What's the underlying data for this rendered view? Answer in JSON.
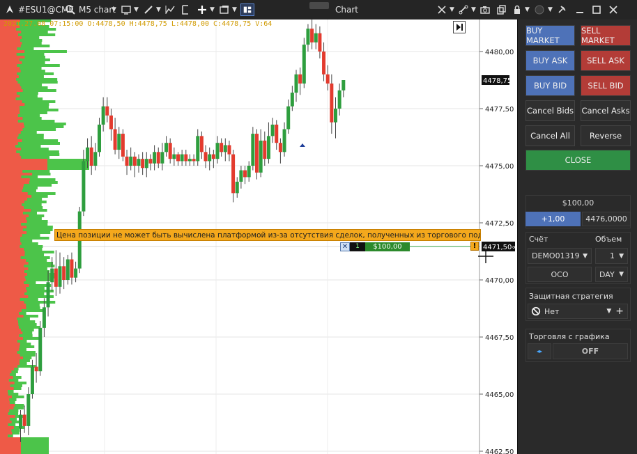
{
  "toolbar": {
    "symbol": "#ESU1@CME",
    "timeframe": "M5 chart",
    "window_title": "Chart",
    "icons": [
      "app-logo-icon",
      "search-icon",
      "chevron-down-icon",
      "display-icon",
      "pencil-icon",
      "line-chart-icon",
      "template-icon",
      "crosshair-plus-icon",
      "window-icon",
      "layout-icon",
      "tools-icon",
      "link-icon",
      "camera-icon",
      "copy-icon",
      "lock-icon",
      "circle-icon",
      "pin-icon",
      "minimize-icon",
      "maximize-icon",
      "close-icon"
    ]
  },
  "chart": {
    "ohlc_text": "2021.27.08 07:15:00 O:4478,50 H:4478,75 L:4478,00 C:4478,75 V:64",
    "price_labels": [
      "4480,00",
      "4477,50",
      "4475,00",
      "4472,50",
      "4470,00",
      "4467,50",
      "4465,00",
      "4462,50"
    ],
    "current_price_label": "4478,75",
    "position_price_label": "4471,50",
    "position_price_suffix": "∞",
    "warning_text": "Цена позиции не может быть вычислена платформой из-за отсутствия сделок, полученных из торгового подключения.",
    "position_qty": "1",
    "position_pnl": "$100,00",
    "warning_badge": "!",
    "colors": {
      "bull": "#2e9e3e",
      "bear": "#e33b2e",
      "profile_red": "#ee5a47",
      "profile_green": "#4cc44a"
    }
  },
  "panel": {
    "buy_market": "BUY MARKET",
    "sell_market": "SELL MARKET",
    "buy_ask": "BUY ASK",
    "sell_ask": "SELL ASK",
    "buy_bid": "BUY BID",
    "sell_bid": "SELL BID",
    "cancel_bids": "Cancel Bids",
    "cancel_asks": "Cancel Asks",
    "cancel_all": "Cancel All",
    "reverse": "Reverse",
    "close": "CLOSE",
    "amount": "$100,00",
    "step": "+1,00",
    "price": "4476,0000",
    "account_label": "Счёт",
    "volume_label": "Объем",
    "account": "DEMO01319",
    "volume": "1",
    "oco": "OCO",
    "tif": "DAY",
    "strategy_label": "Защитная стратегия",
    "strategy_value": "Нет",
    "chart_trading_label": "Торговля с графика",
    "chart_trading_value": "OFF",
    "colors": {
      "blue": "#4e72b8",
      "red": "#b33c37",
      "green": "#2f8f45"
    }
  }
}
